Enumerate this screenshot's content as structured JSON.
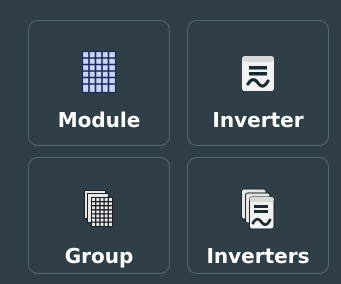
{
  "buttons": {
    "module": {
      "label": "Module",
      "icon": "module-grid-icon"
    },
    "inverter": {
      "label": "Inverter",
      "icon": "inverter-icon"
    },
    "group": {
      "label": "Group",
      "icon": "module-group-icon"
    },
    "inverters": {
      "label": "Inverters",
      "icon": "inverters-stack-icon"
    }
  },
  "colors": {
    "background": "#2f3e47",
    "tile_border": "#566670",
    "label": "#ffffff",
    "module_fill": "#c9d6f5",
    "module_grid": "#1a2a5e",
    "inverter_body": "#f2f2f2",
    "inverter_detail": "#1b2a30"
  }
}
